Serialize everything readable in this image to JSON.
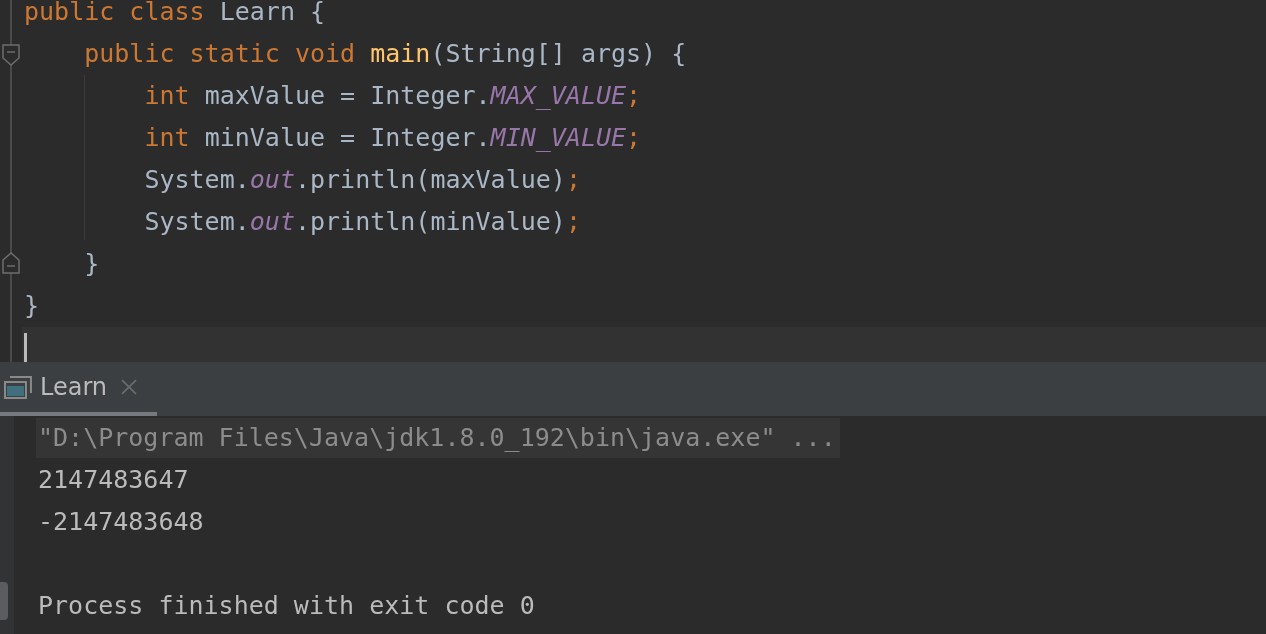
{
  "editor": {
    "lines": [
      {
        "current": false,
        "tokens": [
          {
            "text": "public class ",
            "kind": "keyword"
          },
          {
            "text": "Learn {",
            "kind": "ident"
          }
        ]
      },
      {
        "current": false,
        "tokens": [
          {
            "text": "    public static void ",
            "kind": "keyword"
          },
          {
            "text": "main",
            "kind": "method"
          },
          {
            "text": "(String[] args) {",
            "kind": "ident"
          }
        ]
      },
      {
        "current": false,
        "tokens": [
          {
            "text": "        int ",
            "kind": "keyword"
          },
          {
            "text": "maxValue = Integer.",
            "kind": "ident"
          },
          {
            "text": "MAX_VALUE",
            "kind": "constant"
          },
          {
            "text": ";",
            "kind": "punct"
          }
        ]
      },
      {
        "current": false,
        "tokens": [
          {
            "text": "        int ",
            "kind": "keyword"
          },
          {
            "text": "minValue = Integer.",
            "kind": "ident"
          },
          {
            "text": "MIN_VALUE",
            "kind": "constant"
          },
          {
            "text": ";",
            "kind": "punct"
          }
        ]
      },
      {
        "current": false,
        "tokens": [
          {
            "text": "        System.",
            "kind": "ident"
          },
          {
            "text": "out",
            "kind": "field"
          },
          {
            "text": ".println(maxValue)",
            "kind": "ident"
          },
          {
            "text": ";",
            "kind": "punct"
          }
        ]
      },
      {
        "current": false,
        "tokens": [
          {
            "text": "        System.",
            "kind": "ident"
          },
          {
            "text": "out",
            "kind": "field"
          },
          {
            "text": ".println(minValue)",
            "kind": "ident"
          },
          {
            "text": ";",
            "kind": "punct"
          }
        ]
      },
      {
        "current": false,
        "tokens": [
          {
            "text": "    }",
            "kind": "ident"
          }
        ]
      },
      {
        "current": false,
        "tokens": [
          {
            "text": "}",
            "kind": "ident"
          }
        ]
      },
      {
        "current": true
      }
    ]
  },
  "run_panel": {
    "tabs": [
      {
        "label": "Learn",
        "selected": true
      }
    ],
    "lines": [
      {
        "text": "\"D:\\Program Files\\Java\\jdk1.8.0_192\\bin\\java.exe\" ...",
        "kind": "command"
      },
      {
        "text": "2147483647",
        "kind": "output"
      },
      {
        "text": "-2147483648",
        "kind": "output"
      },
      {
        "text": "Process finished with exit code 0",
        "kind": "exit"
      }
    ]
  }
}
